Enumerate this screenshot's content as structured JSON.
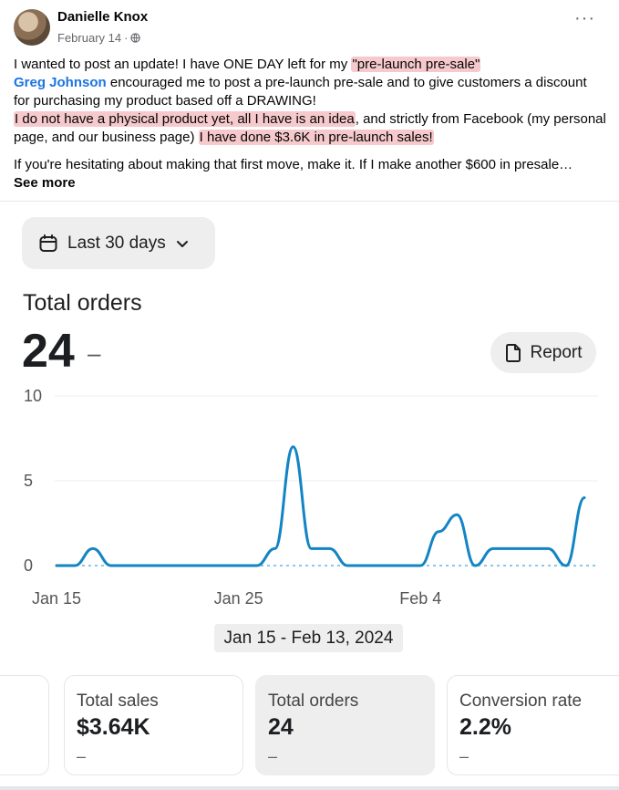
{
  "post": {
    "author": "Danielle Knox",
    "date": "February 14",
    "date_separator": "·",
    "line1_a": "I wanted to post an update! I have ONE DAY left for my ",
    "line1_hl": "\"pre-launch pre-sale\"",
    "mention": "Greg Johnson",
    "line2_b": " encouraged me to post a pre-launch pre-sale and to give customers a discount for purchasing my product based off a DRAWING!",
    "line3_hl": "I do not have a physical product yet, all I have is an idea",
    "line3_b": ", and strictly from Facebook (my personal page, and our business page) ",
    "line4_hl": "I have done $3.6K in pre-launch sales!",
    "para2": "If you're hesitating about making that first move, make it. If I make another $600 in presale…",
    "see_more": "See more"
  },
  "dashboard": {
    "date_range_label": "Last 30 days",
    "title": "Total orders",
    "total": "24",
    "total_change": "–",
    "report_label": "Report",
    "range_caption": "Jan 15 - Feb 13, 2024"
  },
  "chart_data": {
    "type": "line",
    "title": "",
    "xlabel": "",
    "ylabel": "",
    "ylim": [
      0,
      10
    ],
    "y_ticks": [
      "10",
      "5",
      "0"
    ],
    "x_ticks": [
      "Jan 15",
      "Jan 25",
      "Feb 4"
    ],
    "line_color": "#1384c4",
    "grid": true,
    "x": [
      "Jan 15",
      "Jan 16",
      "Jan 17",
      "Jan 18",
      "Jan 19",
      "Jan 20",
      "Jan 21",
      "Jan 22",
      "Jan 23",
      "Jan 24",
      "Jan 25",
      "Jan 26",
      "Jan 27",
      "Jan 28",
      "Jan 29",
      "Jan 30",
      "Jan 31",
      "Feb 1",
      "Feb 2",
      "Feb 3",
      "Feb 4",
      "Feb 5",
      "Feb 6",
      "Feb 7",
      "Feb 8",
      "Feb 9",
      "Feb 10",
      "Feb 11",
      "Feb 12",
      "Feb 13"
    ],
    "series": [
      {
        "values": [
          0,
          0,
          1,
          0,
          0,
          0,
          0,
          0,
          0,
          0,
          0,
          0,
          1,
          7,
          1,
          1,
          0,
          0,
          0,
          0,
          0,
          2,
          3,
          0,
          1,
          1,
          1,
          1,
          0,
          4
        ]
      }
    ]
  },
  "cards": [
    {
      "label": "",
      "value": "",
      "sub": ""
    },
    {
      "label": "Total sales",
      "value": "$3.64K",
      "sub": "–"
    },
    {
      "label": "Total orders",
      "value": "24",
      "sub": "–"
    },
    {
      "label": "Conversion rate",
      "value": "2.2%",
      "sub": "–"
    }
  ]
}
